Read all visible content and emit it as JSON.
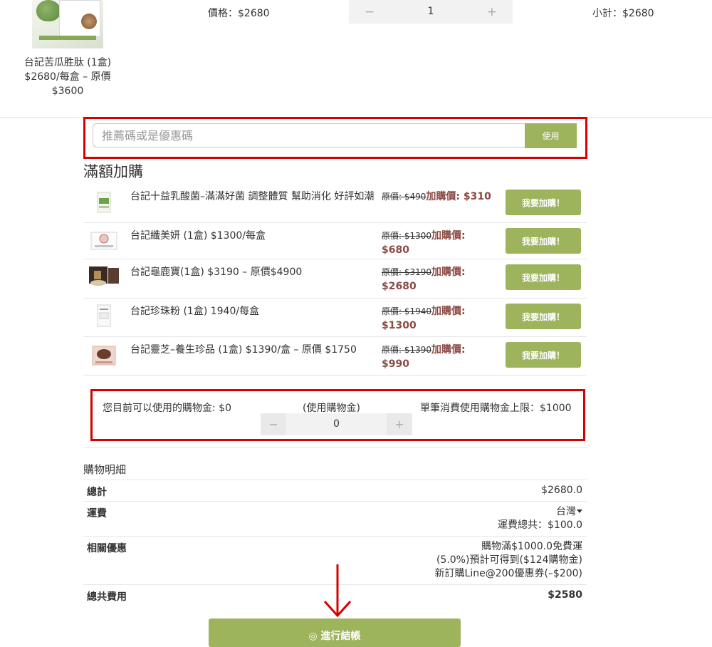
{
  "cart": {
    "item": {
      "name": "台記苦瓜胜肽 (1盒) $2680/每盒 – 原價 $3600",
      "price": "價格：$2680",
      "quantity": "1",
      "minus_symbol": "−",
      "plus_symbol": "+",
      "subtotal": "小計：$2680"
    }
  },
  "coupon": {
    "placeholder": "推薦碼或是優惠碼",
    "apply_label": "使用"
  },
  "addon": {
    "title": "滿額加購",
    "items": [
      {
        "name": "台記十益乳酸菌–滿滿好菌 調整體質 幫助消化 好評如潮",
        "original_price": "原價: $490",
        "sale_price": "加購價: $310",
        "button": "我要加購！"
      },
      {
        "name": "台記纖美妍 (1盒) $1300/每盒",
        "original_price": "原價: $1300",
        "sale_price": "加購價: $680",
        "button": "我要加購！"
      },
      {
        "name": "台記龜鹿寶(1盒) $3190 – 原價$4900",
        "original_price": "原價: $3190",
        "sale_price": "加購價: $2680",
        "button": "我要加購！"
      },
      {
        "name": "台記珍珠粉 (1盒) 1940/每盒",
        "original_price": "原價: $1940",
        "sale_price": "加購價: $1300",
        "button": "我要加購！"
      },
      {
        "name": "台記靈芝–養生珍品 (1盒) $1390/盒 – 原價 $1750",
        "original_price": "原價: $1390",
        "sale_price": "加購價: $990",
        "button": "我要加購！"
      }
    ]
  },
  "points": {
    "available": "您目前可以使用的購物金: $0",
    "use_label": "(使用購物金)",
    "limit": "單筆消費使用購物金上限：$1000",
    "value": "0",
    "minus_symbol": "−",
    "plus_symbol": "+"
  },
  "summary": {
    "title": "購物明細",
    "total_label": "總計",
    "total_value": "$2680.0",
    "shipping_label": "運費",
    "shipping_region": "台灣",
    "shipping_total": "運費總共：$100.0",
    "discount_label": "相關優惠",
    "discount_lines": [
      "購物滿$1000.0免費運",
      "(5.0%)預計可得到($124購物金)",
      "新訂購Line@200優惠券(–$200)"
    ],
    "grand_label": "總共費用",
    "grand_value": "$2580"
  },
  "checkout": {
    "label": "◎ 進行結帳"
  },
  "colors": {
    "accent_green": "#9db35c",
    "highlight_red": "#d60000",
    "sale_price": "#8b4a44"
  }
}
